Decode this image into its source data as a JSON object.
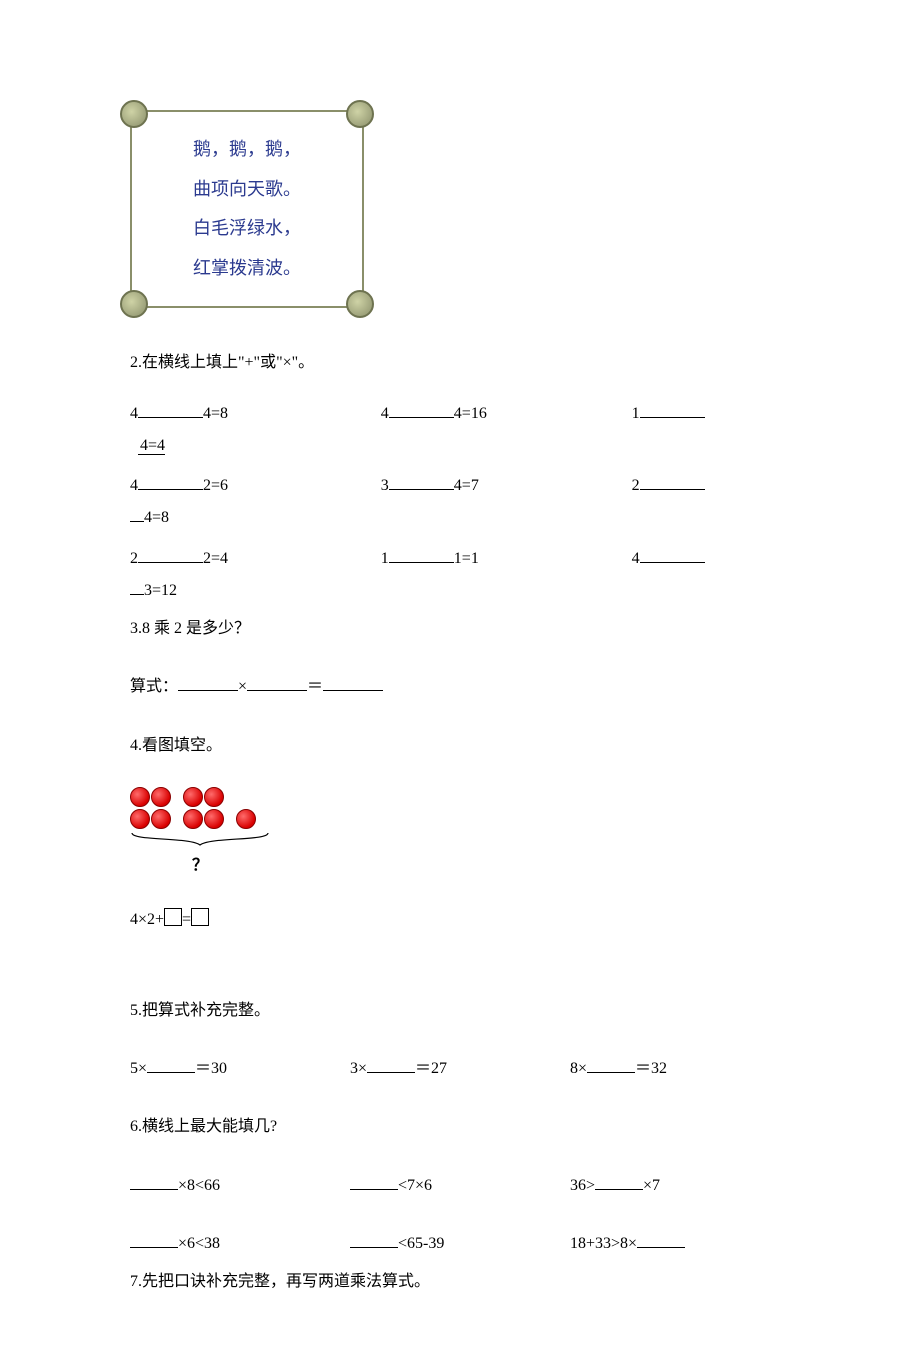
{
  "poem": {
    "l1": "鹅，鹅，鹅，",
    "l2": "曲项向天歌。",
    "l3": "白毛浮绿水，",
    "l4": "红掌拨清波。"
  },
  "q2": {
    "title": "2.在横线上填上\"+\"或\"×\"。",
    "r1c1a": "4",
    "r1c1b": "4=8",
    "r1c2a": "4",
    "r1c2b": "4=16",
    "r1c3a": "1",
    "r1c3b": "4=4",
    "r2c1a": "4",
    "r2c1b": "2=6",
    "r2c2a": "3",
    "r2c2b": "4=7",
    "r2c3a": "2",
    "r2c3b": "4=8",
    "r3c1a": "2",
    "r3c1b": "2=4",
    "r3c2a": "1",
    "r3c2b": "1=1",
    "r3c3a": "4",
    "r3c3b": "3=12"
  },
  "q3": {
    "title": "3.8 乘 2 是多少？",
    "label": "算式：",
    "times": "×",
    "eq": "＝"
  },
  "q4": {
    "title": "4.看图填空。",
    "qmark": "？",
    "expr_a": "4×2+",
    "expr_b": "="
  },
  "q5": {
    "title": "5.把算式补充完整。",
    "c1a": "5×",
    "c1b": "＝30",
    "c2a": "3×",
    "c2b": "＝27",
    "c3a": "8×",
    "c3b": "＝32"
  },
  "q6": {
    "title": "6.横线上最大能填几?",
    "r1c1b": "×8<66",
    "r1c2b": "<7×6",
    "r1c3a": "36>",
    "r1c3b": "×7",
    "r2c1b": "×6<38",
    "r2c2b": "<65-39",
    "r2c3a": "18+33>8×"
  },
  "q7": {
    "title": "7.先把口诀补充完整，再写两道乘法算式。"
  }
}
